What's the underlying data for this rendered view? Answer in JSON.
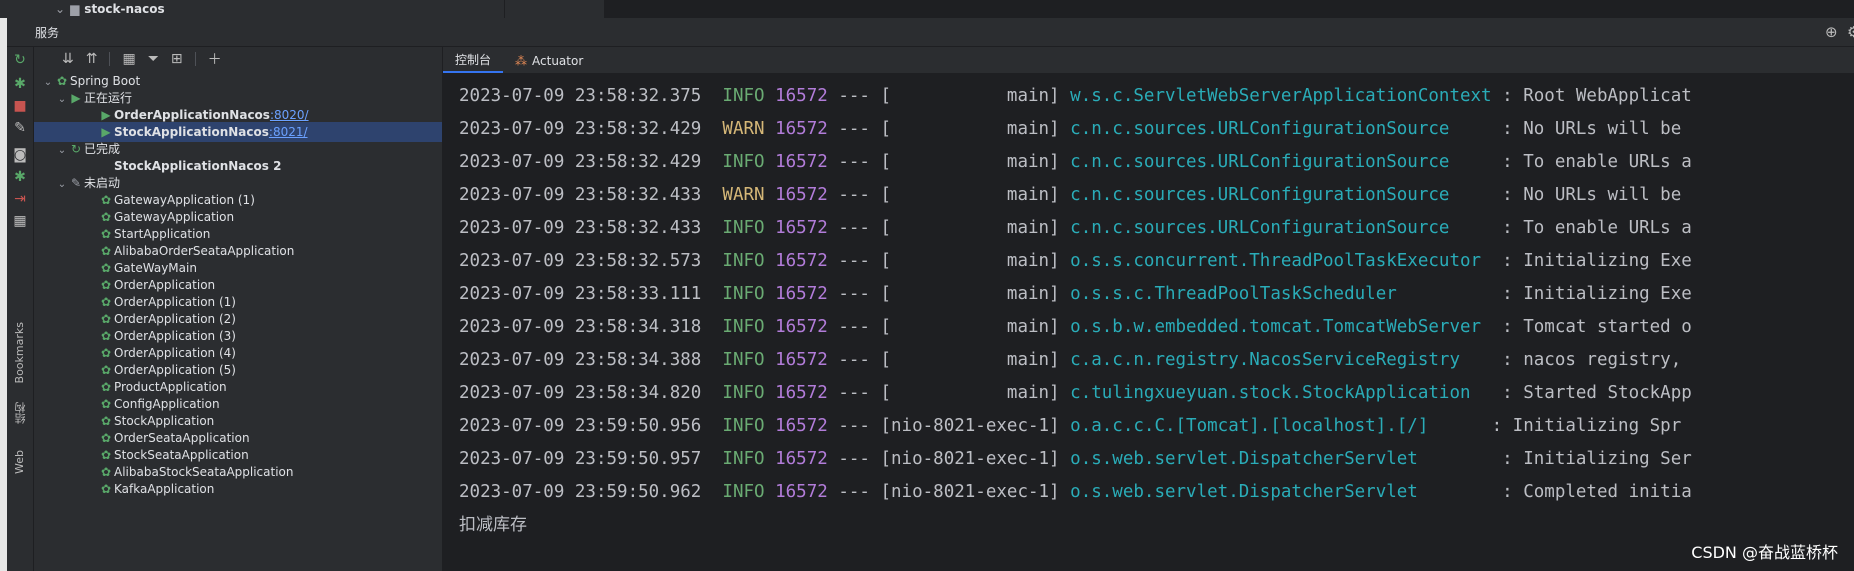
{
  "project": {
    "name": "stock-nacos"
  },
  "services": {
    "title": "服务"
  },
  "side_labels": {
    "bookmarks": "Bookmarks",
    "structure": "结构",
    "web": "Web"
  },
  "tree": {
    "root": "Spring Boot",
    "running_group": "正在运行",
    "running": [
      {
        "name": "OrderApplicationNacos",
        "port": ":8020/"
      },
      {
        "name": "StockApplicationNacos",
        "port": ":8021/"
      }
    ],
    "finished_group": "已完成",
    "finished": [
      "StockApplicationNacos 2"
    ],
    "not_started_group": "未启动",
    "not_started": [
      "GatewayApplication (1)",
      "GatewayApplication",
      "StartApplication",
      "AlibabaOrderSeataApplication",
      "GateWayMain",
      "OrderApplication",
      "OrderApplication (1)",
      "OrderApplication (2)",
      "OrderApplication (3)",
      "OrderApplication (4)",
      "OrderApplication (5)",
      "ProductApplication",
      "ConfigApplication",
      "StockApplication",
      "OrderSeataApplication",
      "StockSeataApplication",
      "AlibabaStockSeataApplication",
      "KafkaApplication"
    ]
  },
  "tabs": [
    {
      "label": "控制台"
    },
    {
      "label": "Actuator"
    }
  ],
  "logs": [
    {
      "ts": "2023-07-09 23:58:32.375",
      "level": "INFO",
      "pid": "16572",
      "thread": "--- [           main]",
      "logger": "w.s.c.ServletWebServerApplicationContext",
      "msg": ": Root WebApplicat"
    },
    {
      "ts": "2023-07-09 23:58:32.429",
      "level": "WARN",
      "pid": "16572",
      "thread": "--- [           main]",
      "logger": "c.n.c.sources.URLConfigurationSource    ",
      "msg": ": No URLs will be"
    },
    {
      "ts": "2023-07-09 23:58:32.429",
      "level": "INFO",
      "pid": "16572",
      "thread": "--- [           main]",
      "logger": "c.n.c.sources.URLConfigurationSource    ",
      "msg": ": To enable URLs a"
    },
    {
      "ts": "2023-07-09 23:58:32.433",
      "level": "WARN",
      "pid": "16572",
      "thread": "--- [           main]",
      "logger": "c.n.c.sources.URLConfigurationSource    ",
      "msg": ": No URLs will be"
    },
    {
      "ts": "2023-07-09 23:58:32.433",
      "level": "INFO",
      "pid": "16572",
      "thread": "--- [           main]",
      "logger": "c.n.c.sources.URLConfigurationSource    ",
      "msg": ": To enable URLs a"
    },
    {
      "ts": "2023-07-09 23:58:32.573",
      "level": "INFO",
      "pid": "16572",
      "thread": "--- [           main]",
      "logger": "o.s.s.concurrent.ThreadPoolTaskExecutor ",
      "msg": ": Initializing Exe"
    },
    {
      "ts": "2023-07-09 23:58:33.111",
      "level": "INFO",
      "pid": "16572",
      "thread": "--- [           main]",
      "logger": "o.s.s.c.ThreadPoolTaskScheduler         ",
      "msg": ": Initializing Exe"
    },
    {
      "ts": "2023-07-09 23:58:34.318",
      "level": "INFO",
      "pid": "16572",
      "thread": "--- [           main]",
      "logger": "o.s.b.w.embedded.tomcat.TomcatWebServer ",
      "msg": ": Tomcat started o"
    },
    {
      "ts": "2023-07-09 23:58:34.388",
      "level": "INFO",
      "pid": "16572",
      "thread": "--- [           main]",
      "logger": "c.a.c.n.registry.NacosServiceRegistry   ",
      "msg": ": nacos registry,"
    },
    {
      "ts": "2023-07-09 23:58:34.820",
      "level": "INFO",
      "pid": "16572",
      "thread": "--- [           main]",
      "logger": "c.tulingxueyuan.stock.StockApplication  ",
      "msg": ": Started StockApp"
    },
    {
      "ts": "2023-07-09 23:59:50.956",
      "level": "INFO",
      "pid": "16572",
      "thread": "--- [nio-8021-exec-1]",
      "logger": "o.a.c.c.C.[Tomcat].[localhost].[/]     ",
      "msg": ": Initializing Spr"
    },
    {
      "ts": "2023-07-09 23:59:50.957",
      "level": "INFO",
      "pid": "16572",
      "thread": "--- [nio-8021-exec-1]",
      "logger": "o.s.web.servlet.DispatcherServlet       ",
      "msg": ": Initializing Ser"
    },
    {
      "ts": "2023-07-09 23:59:50.962",
      "level": "INFO",
      "pid": "16572",
      "thread": "--- [nio-8021-exec-1]",
      "logger": "o.s.web.servlet.DispatcherServlet       ",
      "msg": ": Completed initia"
    }
  ],
  "stdout_line": "扣减库存",
  "watermark": "CSDN @奋战蓝桥杯",
  "colors": {
    "info": "#6aab73",
    "warn": "#d5b778",
    "pid": "#b27cd9",
    "logger": "#2aacb8",
    "selection": "#2e436e"
  }
}
